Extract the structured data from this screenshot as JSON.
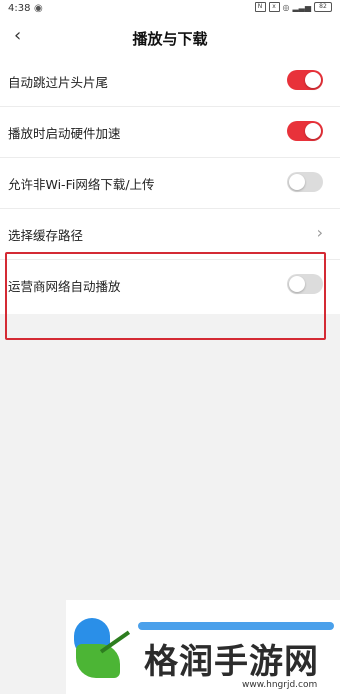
{
  "status_bar": {
    "time": "4:38",
    "battery": "82"
  },
  "header": {
    "back_icon": "chevron-left-icon",
    "title": "播放与下载"
  },
  "settings": [
    {
      "label": "自动跳过片头片尾",
      "control": "toggle",
      "on": true
    },
    {
      "label": "播放时启动硬件加速",
      "control": "toggle",
      "on": true
    },
    {
      "label": "允许非Wi-Fi网络下载/上传",
      "control": "toggle",
      "on": false
    },
    {
      "label": "选择缓存路径",
      "control": "chevron"
    },
    {
      "label": "运营商网络自动播放",
      "control": "toggle",
      "on": false
    }
  ],
  "colors": {
    "accent": "#e8323a",
    "toggle_off": "#dcdcdc",
    "highlight_border": "#d42a34",
    "background": "#f2f2f2"
  },
  "watermark": {
    "brand": "格润手游网",
    "url": "www.hngrjd.com"
  }
}
